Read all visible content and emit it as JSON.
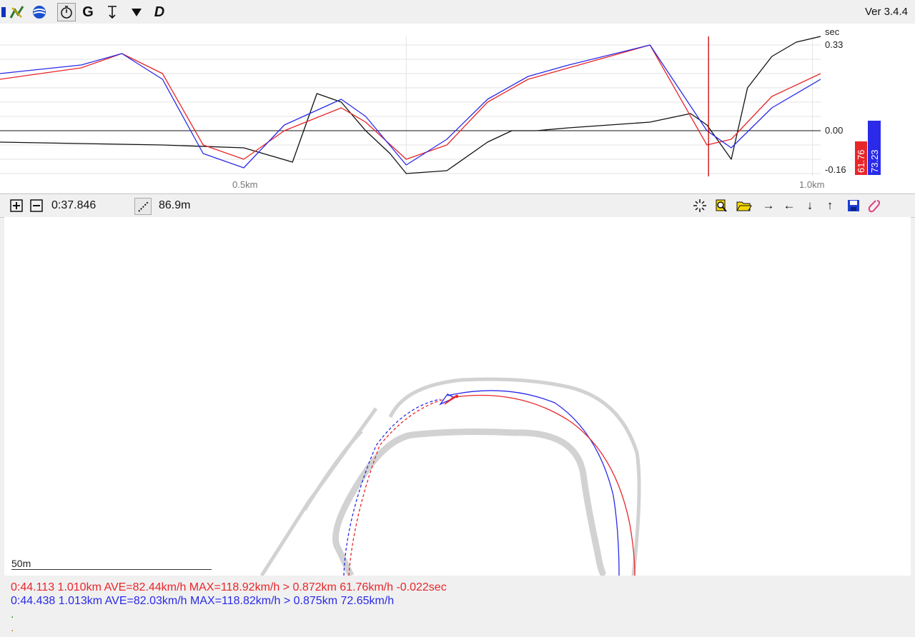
{
  "app": {
    "version": "Ver 3.4.4"
  },
  "toolbar": {
    "icons": [
      "file-icon",
      "chart-tool-icon",
      "globe-icon",
      "stopwatch-icon",
      "g-force-icon",
      "altitude-icon",
      "marker-icon",
      "d-icon"
    ],
    "g_label": "G",
    "d_label": "D"
  },
  "chart": {
    "y_unit": "sec",
    "y_top": "0.33",
    "y_mid": "0.00",
    "y_bot": "-0.16",
    "x_tick_1": "0.5km",
    "x_tick_2": "1.0km",
    "red_speed": "61.76",
    "blue_speed": "73.23",
    "colors": {
      "red": "#e8262a",
      "blue": "#2a2ae8",
      "black": "#111111",
      "cursor": "#c00000"
    }
  },
  "chart_data": {
    "type": "line",
    "xlabel": "",
    "ylabel": "sec",
    "xlim": [
      0.0,
      1.01
    ],
    "ylim": [
      -0.16,
      0.33
    ],
    "cursor_x": 0.872,
    "series": [
      {
        "color": "#111111",
        "x": [
          0.0,
          0.1,
          0.2,
          0.3,
          0.36,
          0.39,
          0.42,
          0.45,
          0.48,
          0.5,
          0.55,
          0.6,
          0.63,
          0.66,
          0.7,
          0.8,
          0.85,
          0.87,
          0.9,
          0.92,
          0.95,
          0.98,
          1.01
        ],
        "y": [
          -0.04,
          -0.045,
          -0.05,
          -0.06,
          -0.11,
          0.13,
          0.1,
          0.0,
          -0.08,
          -0.15,
          -0.14,
          -0.04,
          0.0,
          0.0,
          0.01,
          0.03,
          0.06,
          0.02,
          -0.1,
          0.15,
          0.26,
          0.31,
          0.33
        ]
      },
      {
        "color": "#e8262a",
        "x": [
          0.0,
          0.1,
          0.15,
          0.2,
          0.25,
          0.3,
          0.35,
          0.42,
          0.45,
          0.5,
          0.55,
          0.6,
          0.65,
          0.7,
          0.8,
          0.87,
          0.9,
          0.95,
          1.01
        ],
        "y": [
          0.18,
          0.22,
          0.27,
          0.2,
          -0.05,
          -0.1,
          0.0,
          0.08,
          0.03,
          -0.1,
          -0.05,
          0.1,
          0.18,
          0.22,
          0.3,
          -0.05,
          -0.03,
          0.12,
          0.2
        ]
      },
      {
        "color": "#2a2ae8",
        "x": [
          0.0,
          0.1,
          0.15,
          0.2,
          0.25,
          0.3,
          0.35,
          0.42,
          0.45,
          0.5,
          0.55,
          0.6,
          0.65,
          0.7,
          0.8,
          0.87,
          0.9,
          0.95,
          1.01
        ],
        "y": [
          0.2,
          0.23,
          0.27,
          0.18,
          -0.08,
          -0.13,
          0.02,
          0.11,
          0.05,
          -0.12,
          -0.03,
          0.11,
          0.19,
          0.23,
          0.3,
          0.0,
          -0.06,
          0.08,
          0.18
        ]
      }
    ]
  },
  "mapbar": {
    "time": "0:37.846",
    "distance": "86.9m"
  },
  "map": {
    "scale_label": "50m"
  },
  "info": {
    "line1": "0:44.113 1.010km AVE=82.44km/h MAX=118.92km/h > 0.872km 61.76km/h -0.022sec",
    "line2": "0:44.438 1.013km AVE=82.03km/h MAX=118.82km/h > 0.875km 72.65km/h",
    "line3": ".",
    "line4": ".",
    "colors": {
      "line1": "#e8262a",
      "line2": "#2a2ae8",
      "line3": "#2a8f2a",
      "line4": "#b08a00"
    }
  }
}
